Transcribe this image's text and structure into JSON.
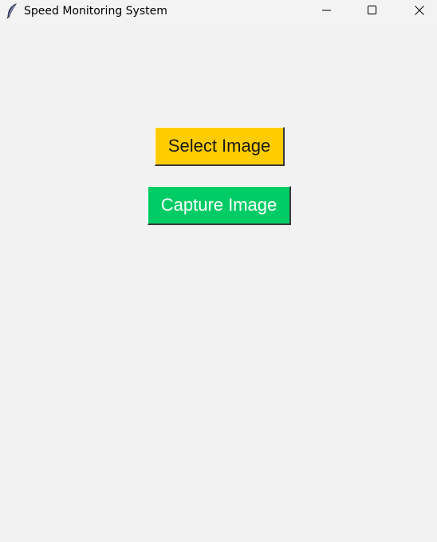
{
  "window": {
    "title": "Speed Monitoring System",
    "icon": "feather-icon",
    "controls": [
      "minimize-icon",
      "maximize-icon",
      "close-icon"
    ]
  },
  "main": {
    "select_button": {
      "label": "Select Image",
      "background": "#ffcc00",
      "text_color": "#1a1a1a"
    },
    "capture_button": {
      "label": "Capture Image",
      "background": "#00cc66",
      "text_color": "#ffffff"
    }
  },
  "colors": {
    "window_background": "#f2f2f2"
  }
}
